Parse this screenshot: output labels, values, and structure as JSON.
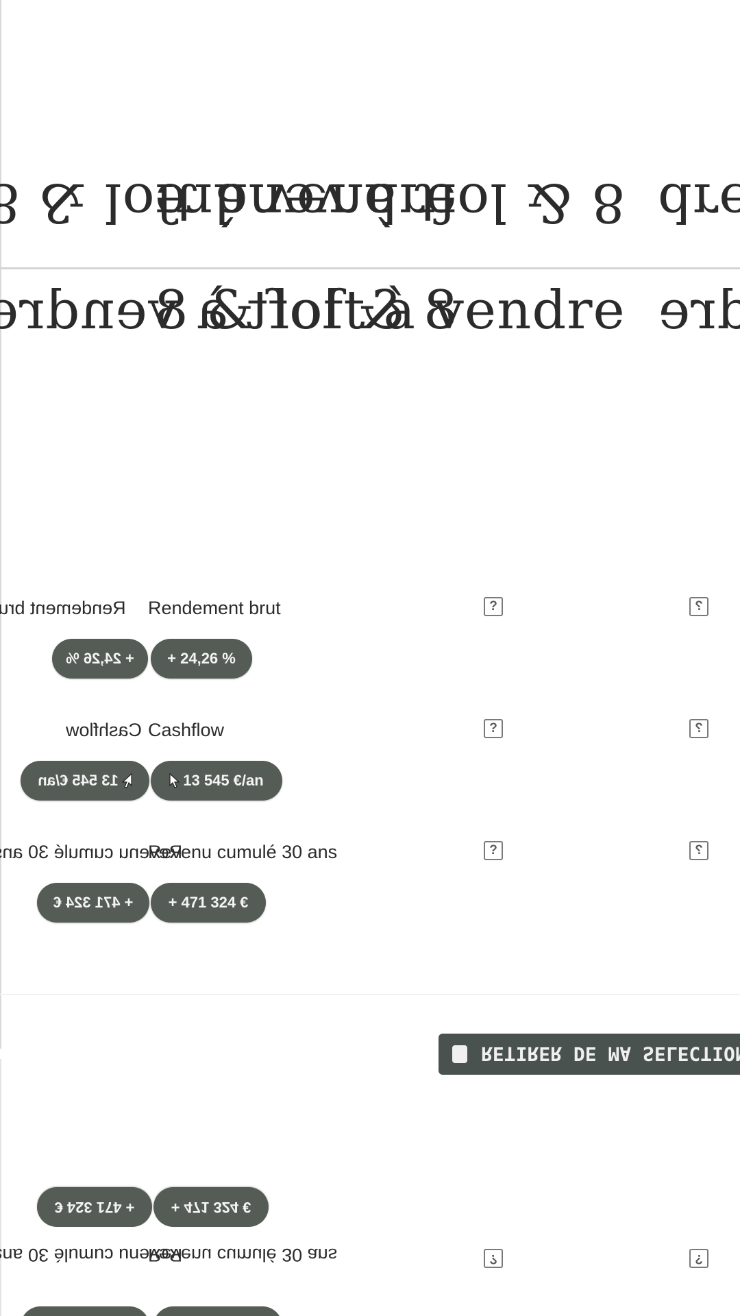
{
  "headline": {
    "title": "8 & loft à vendre",
    "title_prefix_fragment": "loft",
    "title_suffix_fragment": "dre"
  },
  "metrics": [
    {
      "label": "Rendement brut",
      "label_mirror_fragment": "Rendement brut",
      "value": "+ 24,26 %",
      "help_icon": "?"
    },
    {
      "label": "Cashflow",
      "label_mirror_fragment": "Cashflow",
      "value": "13 545 €/an",
      "help_icon": "?"
    },
    {
      "label": "Revenu cumulé 30 ans",
      "label_mirror_fragment": "Revenu cumulé 30 ans",
      "value": "+ 471 324 €",
      "help_icon": "?"
    }
  ],
  "cta": {
    "label": "RETIRER DE MA SELECTION",
    "visible_label": "RETIRER DE MA SELECTION"
  },
  "colors": {
    "pill_bg": "#555c55",
    "cta_bg": "#4a5250",
    "text": "#2b2b2b"
  }
}
